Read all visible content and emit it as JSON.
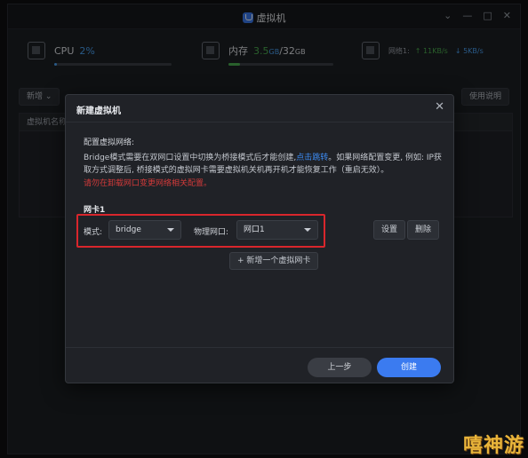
{
  "window": {
    "title": "虚拟机",
    "controls": [
      "⌄",
      "—",
      "□",
      "✕"
    ]
  },
  "stats": {
    "cpu_label": "CPU",
    "cpu_value": "2%",
    "cpu_fraction": 0.02,
    "mem_label": "内存",
    "mem_used": "3.5",
    "mem_used_unit": "GB",
    "mem_total": "/32",
    "mem_total_unit": "GB",
    "mem_fraction": 0.11,
    "net_label": "网络1:",
    "net_up": "↑ 11KB/s",
    "net_down": "↓ 5KB/s"
  },
  "toolbar": {
    "new_label": "新增 ⌄",
    "help_label": "使用说明"
  },
  "list": {
    "header": "虚拟机名称"
  },
  "modal": {
    "title": "新建虚拟机",
    "section_label": "配置虚拟网络:",
    "desc_part1": "Bridge模式需要在双网口设置中切换为桥接模式后才能创建,",
    "desc_link": "点击跳转",
    "desc_part2": "。如果网络配置变更, 例如: IP获取方式调整后, 桥接模式的虚拟网卡需要虚拟机关机再开机才能恢复工作（重启无效）。",
    "warning": "请勿在卸载网口变更网络相关配置。",
    "nic_label": "网卡1",
    "mode_label": "模式:",
    "mode_value": "bridge",
    "phys_label": "物理网口:",
    "phys_value": "网口1",
    "settings_btn": "设置",
    "delete_btn": "删除",
    "add_nic_btn": "+ 新增一个虚拟网卡",
    "prev_btn": "上一步",
    "create_btn": "创建"
  },
  "watermark": {
    "text": "嘻神游"
  },
  "colors": {
    "accent": "#3b7bf0",
    "cpu": "#4aa3f5",
    "mem": "#4caf50",
    "highlight_box": "#d9262c",
    "warning": "#d23a3a"
  }
}
